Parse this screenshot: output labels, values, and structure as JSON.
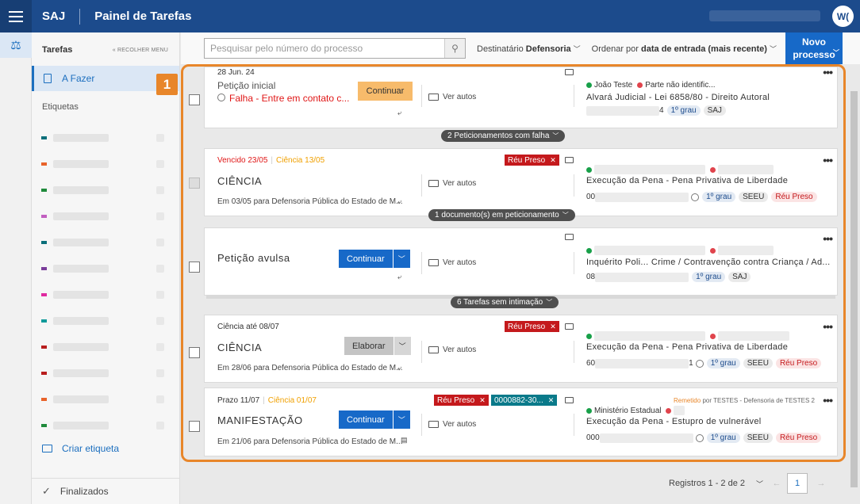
{
  "header": {
    "brand": "SAJ",
    "title": "Painel de Tarefas",
    "avatar": "W("
  },
  "sidebar": {
    "title": "Tarefas",
    "collapse_label": "« RECOLHER MENU",
    "todo_label": "A Fazer",
    "tags_label": "Etiquetas",
    "tag_colors": [
      "#0b6f7a",
      "#e8632a",
      "#1f8a3b",
      "#c25fc0",
      "#0b6f7a",
      "#7a3d9a",
      "#e02aa0",
      "#119a9a",
      "#b81e1e",
      "#b81e1e",
      "#e8632a",
      "#1f8a3b"
    ],
    "create_tag": "Criar etiqueta",
    "finalized": "Finalizados"
  },
  "toolbar": {
    "search_placeholder": "Pesquisar pelo número do processo",
    "dest_label": "Destinatário",
    "dest_value": "Defensoria",
    "order_label": "Ordenar por",
    "order_value": "data de entrada (mais recente)",
    "new_button": "Novo processo"
  },
  "highlight_badge": "1",
  "groups": {
    "g1": "2 Peticionamentos com falha",
    "g2": "1 documento(s) em peticionamento",
    "g3": "6 Tarefas sem intimação"
  },
  "cards": {
    "c1": {
      "date": "28 Jun. 24",
      "title": "Petição inicial",
      "error": "Falha - Entre em contato c...",
      "button": "Continuar",
      "autos": "Ver autos",
      "party1": "João Teste",
      "party2": "Parte não identific...",
      "subject": "Alvará Judicial - Lei 6858/80 - Direito Autoral",
      "num_tail": "4",
      "pill1": "1º grau",
      "pill2": "SAJ"
    },
    "c2": {
      "due": "Vencido 23/05",
      "ciencia": "Ciência 13/05",
      "badge": "Réu Preso",
      "title": "CIÊNCIA",
      "sub": "Em 03/05 para Defensoria Pública do Estado de M...",
      "autos": "Ver autos",
      "subject": "Execução da Pena - Pena Privativa de Liberdade",
      "num_head": "00",
      "pill1": "1º grau",
      "pill2": "SEEU",
      "pill3": "Réu Preso"
    },
    "c3": {
      "title": "Petição avulsa",
      "button": "Continuar",
      "autos": "Ver autos",
      "subject": "Inquérito Poli...  Crime / Contravenção contra Criança / Ad...",
      "num_head": "08",
      "pill1": "1º grau",
      "pill2": "SAJ"
    },
    "c4": {
      "due": "Ciência até 08/07",
      "badge": "Réu Preso",
      "title": "CIÊNCIA",
      "button": "Elaborar",
      "sub": "Em 28/06 para Defensoria Pública do Estado de M...",
      "autos": "Ver autos",
      "subject": "Execução da Pena - Pena Privativa de Liberdade",
      "num_head": "60",
      "num_tail": "1",
      "pill1": "1º grau",
      "pill2": "SEEU",
      "pill3": "Réu Preso"
    },
    "c5": {
      "due": "Prazo 11/07",
      "ciencia": "Ciência 01/07",
      "badge": "Réu Preso",
      "badge2": "0000882-30...",
      "title": "MANIFESTAÇÃO",
      "button": "Continuar",
      "sub": "Em 21/06 para Defensoria Pública do Estado de M...",
      "autos": "Ver autos",
      "remetido_label": "Remetido",
      "remetido": "por TESTES - Defensoria de TESTES 2",
      "party1": "Ministério Estadual",
      "subject": "Execução da Pena - Estupro de vulnerável",
      "num_head": "000",
      "pill1": "1º grau",
      "pill2": "SEEU",
      "pill3": "Réu Preso"
    }
  },
  "pager": {
    "records": "Registros 1 - 2 de 2",
    "page": "1"
  }
}
